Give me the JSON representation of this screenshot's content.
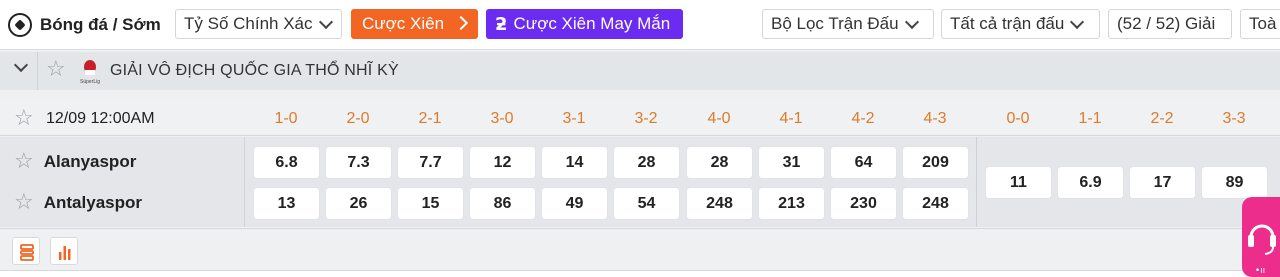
{
  "toolbar": {
    "title": "Bóng đá / Sớm",
    "market_select": "Tỷ Số Chính Xác",
    "parlay_button": "Cược Xiên",
    "lucky_parlay_button": "Cược Xiên May Mắn",
    "match_filter": "Bộ Lọc Trận Đấu",
    "all_matches": "Tất cả trận đấu",
    "league_count": "(52 / 52) Giải",
    "overflow_text": "Toà",
    "colors": {
      "parlay": "#f26522",
      "lucky_parlay": "#6c2bf0"
    }
  },
  "league": {
    "name": "GIẢI VÔ ĐỊCH QUỐC GIA THỔ NHĨ KỲ",
    "logo_text": "SüperLig"
  },
  "match": {
    "time": "12/09 12:00AM",
    "score_headers": [
      "1-0",
      "2-0",
      "2-1",
      "3-0",
      "3-1",
      "3-2",
      "4-0",
      "4-1",
      "4-2",
      "4-3"
    ],
    "draw_headers": [
      "0-0",
      "1-1",
      "2-2",
      "3-3"
    ],
    "home_team": "Alanyaspor",
    "away_team": "Antalyaspor",
    "home_odds": [
      "6.8",
      "7.3",
      "7.7",
      "12",
      "14",
      "28",
      "28",
      "31",
      "64",
      "209"
    ],
    "away_odds": [
      "13",
      "26",
      "15",
      "86",
      "49",
      "54",
      "248",
      "213",
      "230",
      "248"
    ],
    "draw_odds": [
      "11",
      "6.9",
      "17",
      "89"
    ],
    "score_header_color": "#e07a28"
  },
  "footer": {
    "icons": [
      "list-icon",
      "stats-icon"
    ]
  },
  "support": {
    "color": "#ec2d8c",
    "icon": "headset-icon"
  }
}
